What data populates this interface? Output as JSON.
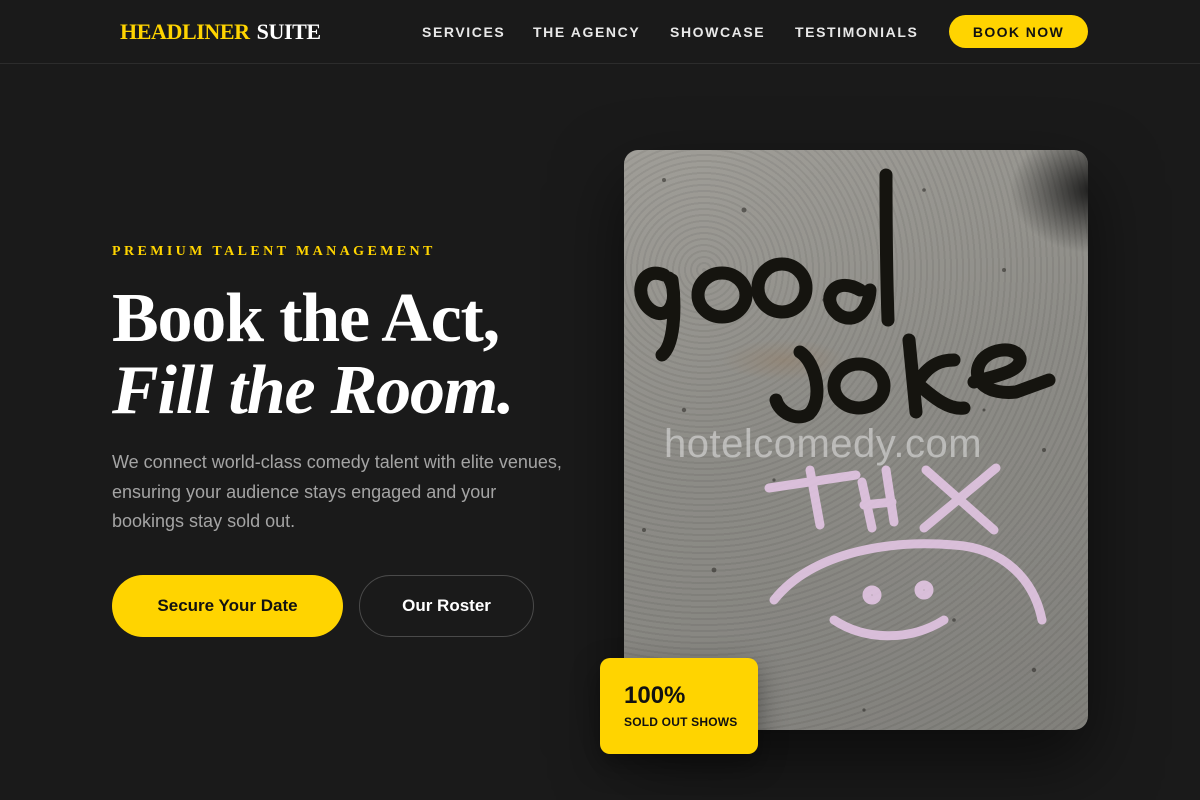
{
  "header": {
    "logo": {
      "part1": "HEADLINER",
      "part2": "SUITE"
    },
    "nav": [
      "SERVICES",
      "THE AGENCY",
      "SHOWCASE",
      "TESTIMONIALS"
    ],
    "cta": "BOOK NOW"
  },
  "hero": {
    "eyebrow": "PREMIUM TALENT MANAGEMENT",
    "headline_line1": "Book the Act,",
    "headline_line2": "Fill the Room.",
    "description": "We connect world-class comedy talent with elite venues, ensuring your audience stays engaged and your bookings stay sold out.",
    "primary_button": "Secure Your Date",
    "secondary_button": "Our Roster",
    "image": {
      "watermark": "hotelcomedy.com",
      "graffiti_text": [
        "good",
        "joke",
        "THX"
      ]
    },
    "stat": {
      "value": "100%",
      "label": "SOLD OUT SHOWS"
    }
  },
  "colors": {
    "background": "#1a1a1a",
    "accent": "#ffd400",
    "text_primary": "#ffffff",
    "text_muted": "#a4a4a4"
  }
}
